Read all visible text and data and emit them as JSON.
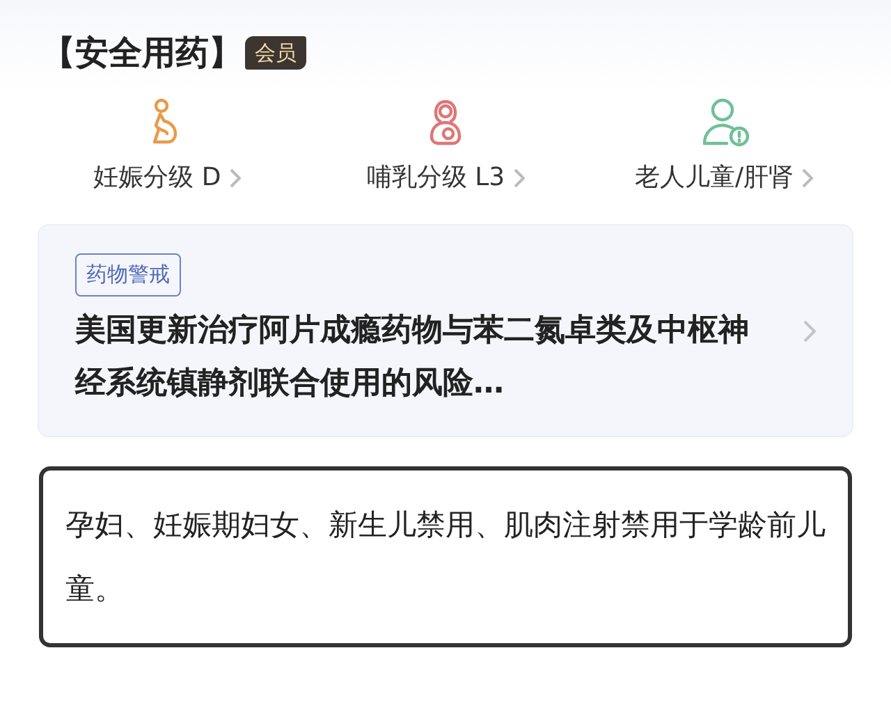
{
  "section": {
    "title": "【安全用药】",
    "badge": "会员"
  },
  "categories": [
    {
      "kind": "pregnancy",
      "label": "妊娠分级 D",
      "color": "#e99a4a"
    },
    {
      "kind": "lactation",
      "label": "哺乳分级 L3",
      "color": "#e07575"
    },
    {
      "kind": "special-population",
      "label": "老人儿童/肝肾",
      "color": "#6fbf98"
    }
  ],
  "alert_card": {
    "tag": "药物警戒",
    "headline": "美国更新治疗阿片成瘾药物与苯二氮卓类及中枢神经系统镇静剂联合使用的风险…"
  },
  "note": "孕妇、妊娠期妇女、新生儿禁用、肌肉注射禁用于学龄前儿童。"
}
